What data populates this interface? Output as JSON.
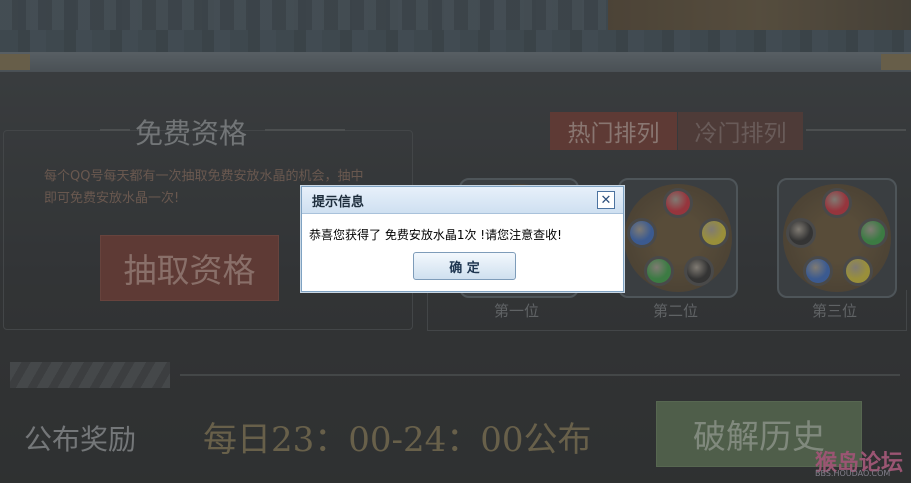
{
  "free": {
    "title": "免费资格",
    "description": "每个QQ号每天都有一次抽取免费安放水晶的机会，抽中即可免费安放水晶一次!",
    "draw_button": "抽取资格"
  },
  "tabs": {
    "hot": "热门排列",
    "cold": "冷门排列"
  },
  "rankings": [
    {
      "label": "第一位"
    },
    {
      "label": "第二位",
      "gems": [
        "#e0313f",
        "#3b74d6",
        "#e6d43a",
        "#3cb04a",
        "#2f2f2f"
      ]
    },
    {
      "label": "第三位",
      "gems": [
        "#e0313f",
        "#2f2f2f",
        "#3cb04a",
        "#3b74d6",
        "#e6d43a"
      ]
    }
  ],
  "bottom": {
    "publish_label": "公布奖励",
    "publish_time": "每日23：00-24：00公布",
    "history_button": "破解历史"
  },
  "dialog": {
    "title": "提示信息",
    "close": "✕",
    "message": "恭喜您获得了 免费安放水晶1次 !请您注意查收!",
    "ok_button": "确 定"
  },
  "watermark": {
    "name": "猴岛论坛",
    "url": "BBS.HOUDAO.COM"
  }
}
